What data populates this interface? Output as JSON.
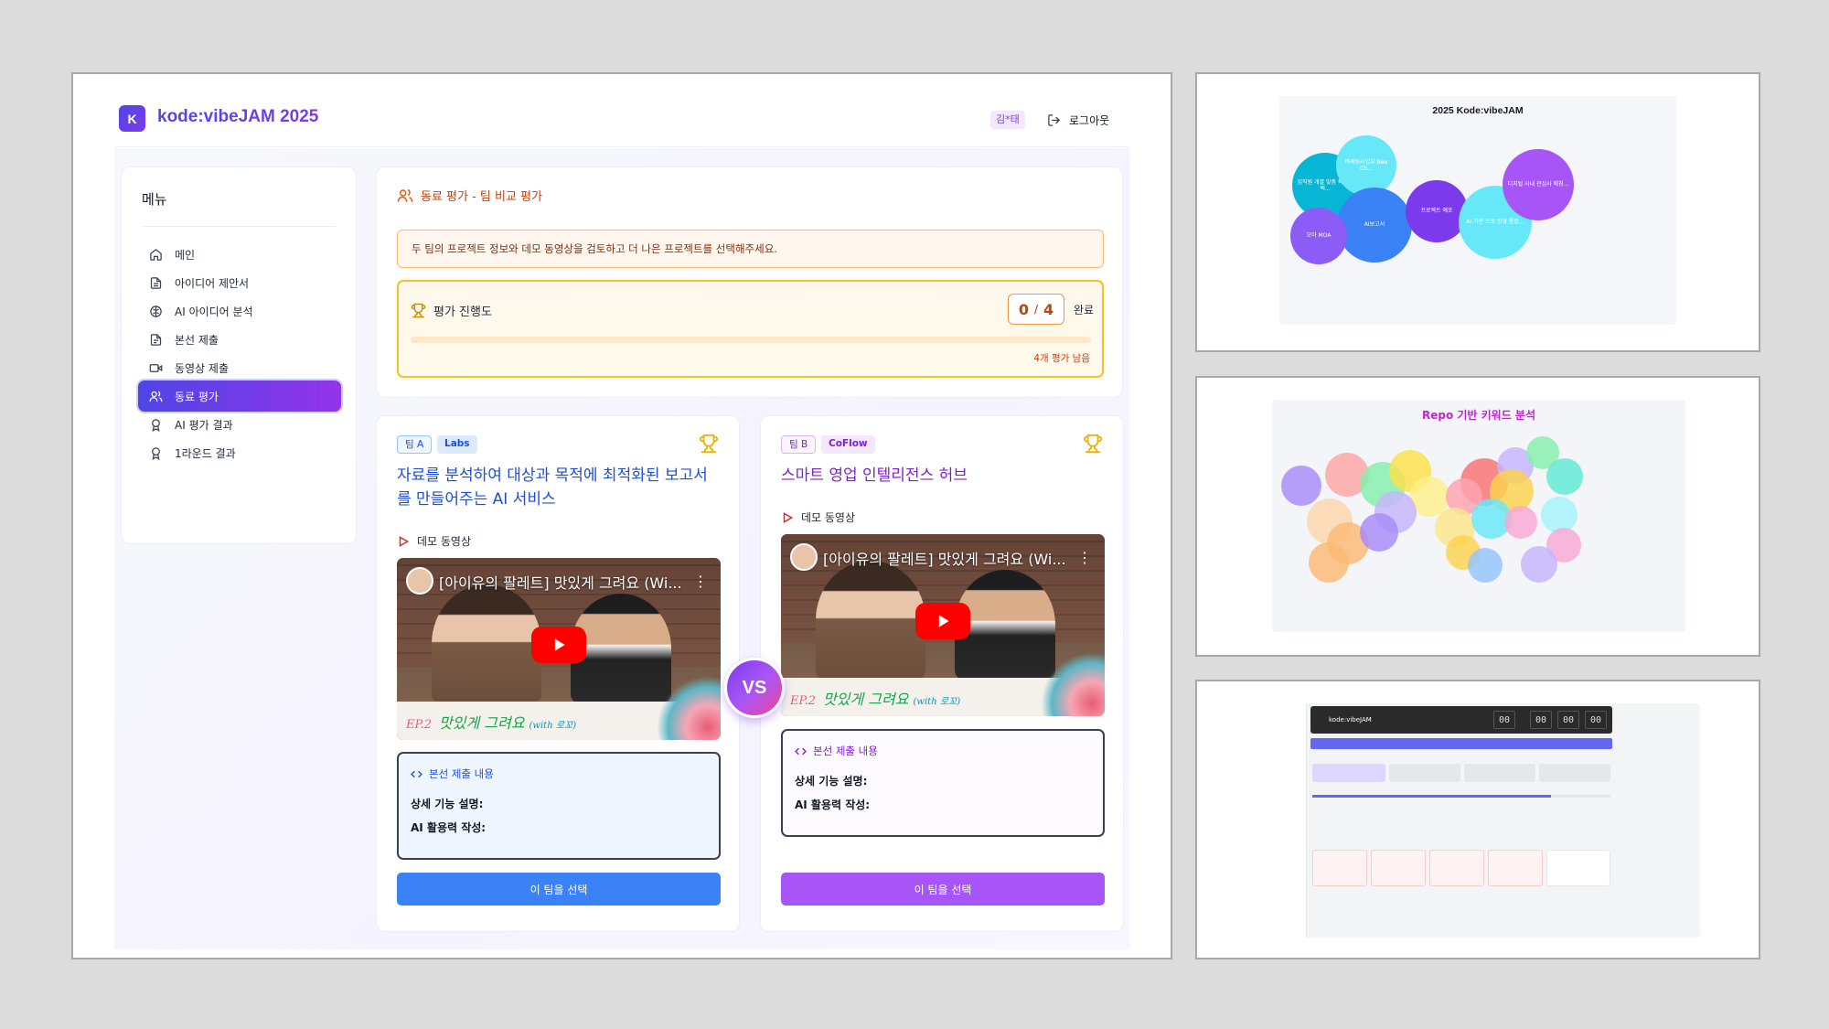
{
  "app": {
    "logo_letter": "K",
    "title": "kode:vibeJAM 2025",
    "user": "김*태",
    "logout": "로그아웃"
  },
  "sidebar": {
    "title": "메뉴",
    "items": [
      {
        "label": "메인",
        "icon": "home-icon"
      },
      {
        "label": "아이디어 제안서",
        "icon": "document-icon"
      },
      {
        "label": "AI 아이디어 분석",
        "icon": "brain-icon"
      },
      {
        "label": "본선 제출",
        "icon": "file-text-icon"
      },
      {
        "label": "동영상 제출",
        "icon": "video-icon"
      },
      {
        "label": "동료 평가",
        "icon": "users-icon",
        "active": true
      },
      {
        "label": "AI 평가 결과",
        "icon": "award-icon"
      },
      {
        "label": "1라운드 결과",
        "icon": "award-icon"
      }
    ]
  },
  "evaluation": {
    "title": "동료 평가 - 팀 비교 평가",
    "notice": "두 팀의 프로젝트 정보와 데모 동영상을 검토하고 더 나은 프로젝트를 선택해주세요.",
    "progress_label": "평가 진행도",
    "completed": "0",
    "separator": "/",
    "total": "4",
    "completed_suffix": "완료",
    "progress_fraction": 0,
    "remaining": "4개 평가 남음"
  },
  "team_a": {
    "label": "팀 A",
    "name": "Labs",
    "title": "자료를 분석하여 대상과 목적에 최적화된 보고서를 만들어주는 AI 서비스",
    "demo_label": "데모 동영상",
    "video_title": "[아이유의 팔레트] 맛있게 그려요 (Wi...",
    "video_caption_num": "EP.2",
    "video_caption": "맛있게 그려요",
    "video_caption_with": "(with 로꼬)",
    "submission_head": "본선 제출 내용",
    "detail_label": "상세 기능 설명:",
    "ai_label": "AI 활용력 작성:",
    "select_button": "이 팀을 선택"
  },
  "team_b": {
    "label": "팀 B",
    "name": "CoFlow",
    "title": "스마트 영업 인텔리전스 허브",
    "demo_label": "데모 동영상",
    "video_title": "[아이유의 팔레트] 맛있게 그려요 (Wi...",
    "video_caption_num": "EP.2",
    "video_caption": "맛있게 그려요",
    "video_caption_with": "(with 로꼬)",
    "submission_head": "본선 제출 내용",
    "detail_label": "상세 기능 설명:",
    "ai_label": "AI 활용력 작성:",
    "select_button": "이 팀을 선택"
  },
  "vs": "VS",
  "thumbnails": {
    "bubble_chart": {
      "title": "2025 Kode:vibeJAM",
      "bubbles": [
        {
          "text": "임직원 개별 맞춤 복지제택...",
          "color": "#06b6d4"
        },
        {
          "text": "마케팅사업부 Bee Ch...",
          "color": "#67e8f9"
        },
        {
          "text": "AI보고서",
          "color": "#3b82f6"
        },
        {
          "text": "모아 MOA",
          "color": "#8b5cf6"
        },
        {
          "text": "프로젝트 예포",
          "color": "#7c3aed"
        },
        {
          "text": "AI 기반 프로 방경 통합...",
          "color": "#67e8f9"
        },
        {
          "text": "디지털 사내 관심사 매칭...",
          "color": "#a855f7"
        }
      ]
    },
    "keyword_chart": {
      "title": "Repo 기반 키워드 분석"
    },
    "dashboard": {
      "brand": "kode:vibeJAM",
      "clock": [
        "00",
        "00",
        "00",
        "00"
      ]
    }
  },
  "colors": {
    "primary": "#4f46e5",
    "accent": "#9333ea",
    "warning": "#f97316",
    "team_a": "#3b82f6",
    "team_b": "#a855f7"
  }
}
